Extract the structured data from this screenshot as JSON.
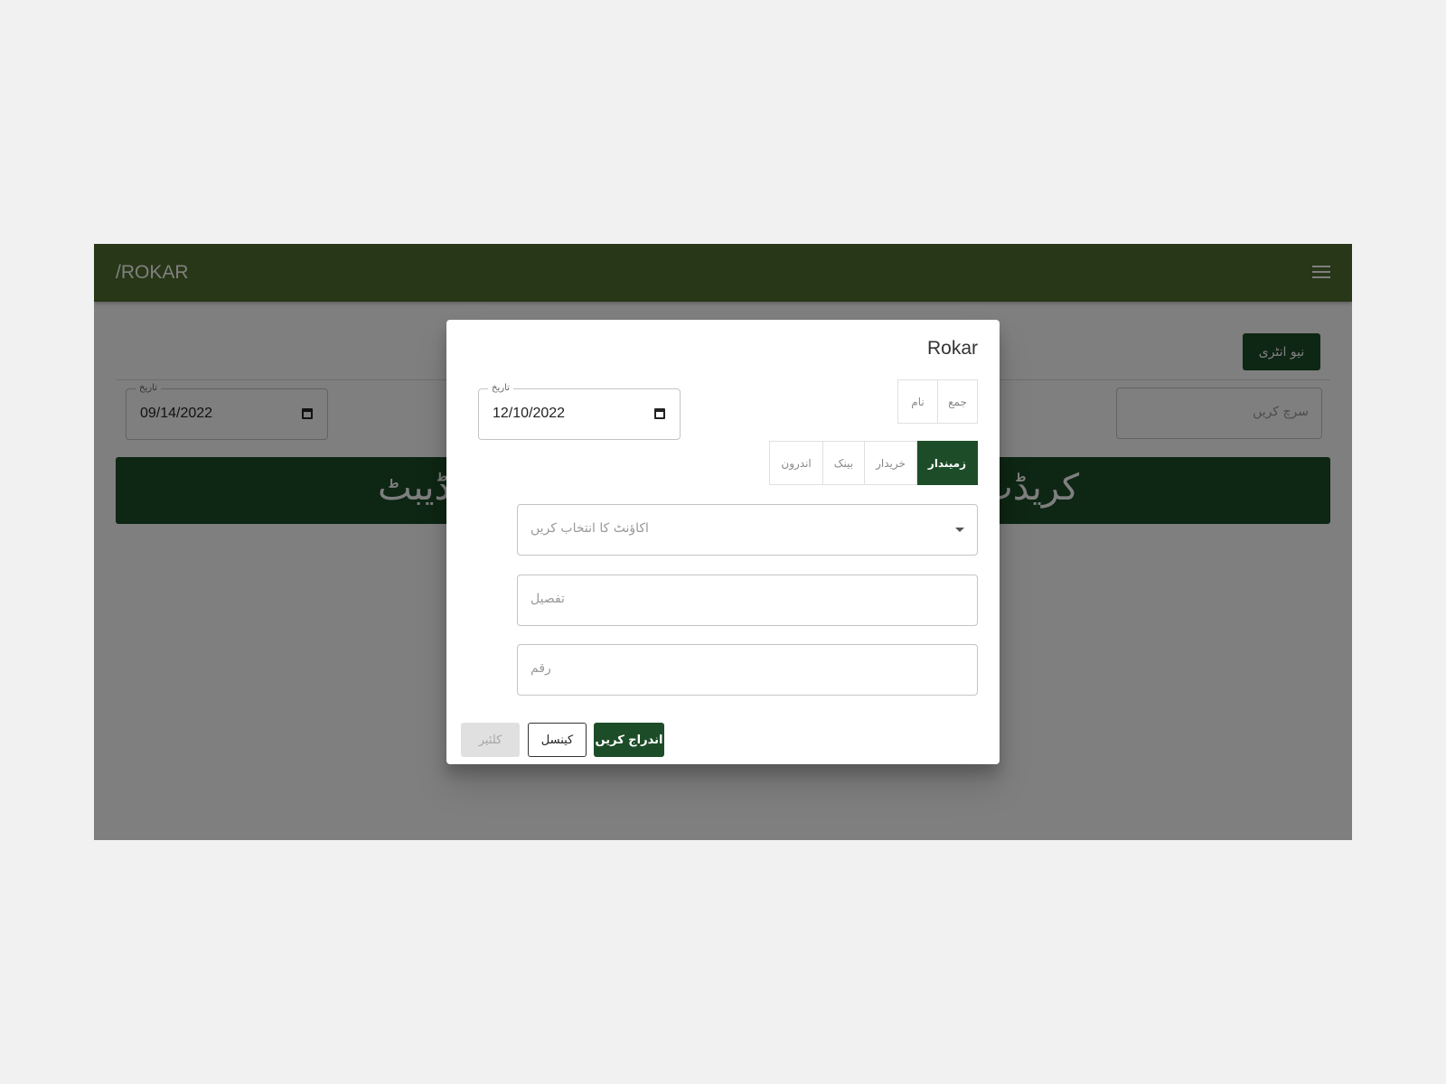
{
  "navbar": {
    "brand": "/ROKAR",
    "menu_icon": "hamburger-menu-icon"
  },
  "page": {
    "new_entry_button": "نیو انٹری",
    "date_label": "تاریخ",
    "date_value": "09/14/2022",
    "search_placeholder": "سرچ کریں",
    "banner_debit": "ڈیبٹ",
    "banner_credit": "کریڈٹ"
  },
  "modal": {
    "title": "Rokar",
    "date_label": "تاریخ",
    "date_value": "12/10/2022",
    "type_toggle": [
      {
        "label": "جمع",
        "active": false
      },
      {
        "label": "نام",
        "active": false
      }
    ],
    "category_toggle": [
      {
        "label": "زمیندار",
        "active": true
      },
      {
        "label": "خریدار",
        "active": false
      },
      {
        "label": "بینک",
        "active": false
      },
      {
        "label": "اندرون",
        "active": false
      }
    ],
    "account_placeholder": "اکاؤنٹ کا انتخاب کریں",
    "detail_placeholder": "تفصیل",
    "amount_placeholder": "رقم",
    "buttons": {
      "clear": "کلئیر",
      "cancel": "کینسل",
      "submit": "اندراج کریں"
    }
  },
  "colors": {
    "navbar": "#4e6f2e",
    "primary": "#1d4d28",
    "page_background": "#f1f1f1"
  }
}
